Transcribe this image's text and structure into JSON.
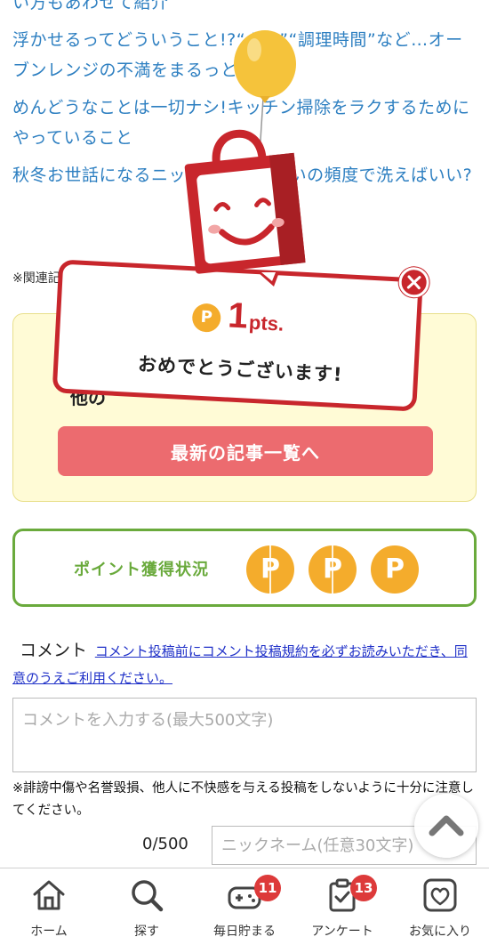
{
  "article_links": [
    "い方もあわせて紹介",
    "浮かせるってどういうこと!?“ムラ”“調理時間”など…オーブンレンジの不満をまるっと解決!",
    "めんどうなことは一切ナシ!キッチン掃除をラクするためにやっていること",
    "秋冬お世話になるニット、どれくらいの頻度で洗えばいい?"
  ],
  "related_note": "※関連記事",
  "yellow_box": {
    "hidden_text": "他の",
    "button_label": "最新の記事一覧へ"
  },
  "points_status": {
    "label": "ポイント獲得状況",
    "coin_symbol": "P",
    "coins": 3,
    "colors": {
      "coin": "#f4ac2c",
      "border": "#6aaa3c"
    }
  },
  "popup": {
    "coin_symbol": "P",
    "points_value": "1",
    "points_unit": "pts.",
    "message": "おめでとうございます!",
    "close_label": "×",
    "accent_color": "#c8262c"
  },
  "comment": {
    "title": "コメント",
    "rules_link": "コメント投稿前にコメント投稿規約を必ずお読みいただき、同意のうえご利用ください。",
    "placeholder": "コメントを入力する(最大500文字)",
    "note": "※誹謗中傷や名誉毀損、他人に不快感を与える投稿をしないように十分に注意してください。",
    "counter": "0/500",
    "nickname_placeholder": "ニックネーム(任意30文字)"
  },
  "scroll_top": {
    "icon": "chevron-up-icon"
  },
  "bottom_nav": [
    {
      "label": "ホーム",
      "icon": "home-icon",
      "badge": ""
    },
    {
      "label": "探す",
      "icon": "search-icon",
      "badge": ""
    },
    {
      "label": "毎日貯まる",
      "icon": "gamepad-icon",
      "badge": "11"
    },
    {
      "label": "アンケート",
      "icon": "clipboard-check-icon",
      "badge": "13"
    },
    {
      "label": "お気に入り",
      "icon": "heart-icon",
      "badge": ""
    }
  ]
}
